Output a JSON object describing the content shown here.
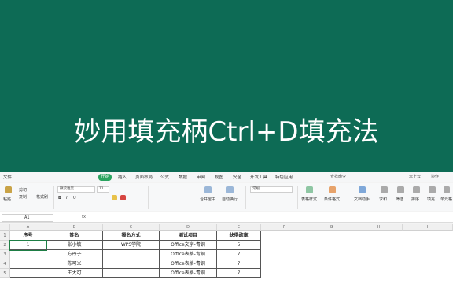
{
  "title_panel": {
    "title": "妙用填充柄Ctrl+D填充法"
  },
  "menubar": {
    "items": [
      {
        "label": "文件"
      },
      {
        "label": "开始",
        "active": true
      },
      {
        "label": "插入"
      },
      {
        "label": "页面布局"
      },
      {
        "label": "公式"
      },
      {
        "label": "数据"
      },
      {
        "label": "审阅"
      },
      {
        "label": "视图"
      },
      {
        "label": "安全"
      },
      {
        "label": "开发工具"
      },
      {
        "label": "特色应用"
      }
    ],
    "right": {
      "tool_a": "查找命令",
      "tool_b": "未上云",
      "tool_c": "协作"
    }
  },
  "ribbon": {
    "paste": "粘贴",
    "cut": "剪切",
    "copy": "复制",
    "format_painter": "格式刷",
    "font_name": "微软雅黑",
    "font_size": "11",
    "merge": "合并居中",
    "wrap": "自动换行",
    "number_format": "常规",
    "table_style": "表格样式",
    "cond_format": "条件格式",
    "doc_assist": "文档助手",
    "sum": "求和",
    "filter": "筛选",
    "sort": "排序",
    "fill": "填充",
    "cell": "单元格"
  },
  "formulabar": {
    "name_box": "A1",
    "fx": "fx"
  },
  "grid": {
    "columns": [
      "A",
      "B",
      "C",
      "D",
      "E",
      "F",
      "G",
      "H",
      "I"
    ],
    "rows": [
      "1",
      "2",
      "3",
      "4",
      "5"
    ],
    "headers": [
      "序号",
      "姓名",
      "报名方式",
      "测试项目",
      "获得勋章"
    ],
    "data": [
      [
        "1",
        "张小敏",
        "WPS学院",
        "Office文字-青铜",
        "5"
      ],
      [
        "",
        "方丹子",
        "",
        "Office表格-青铜",
        "7"
      ],
      [
        "",
        "陈可义",
        "",
        "Office表格-青铜",
        "7"
      ],
      [
        "",
        "王大可",
        "",
        "Office表格-青铜",
        "7"
      ]
    ]
  }
}
